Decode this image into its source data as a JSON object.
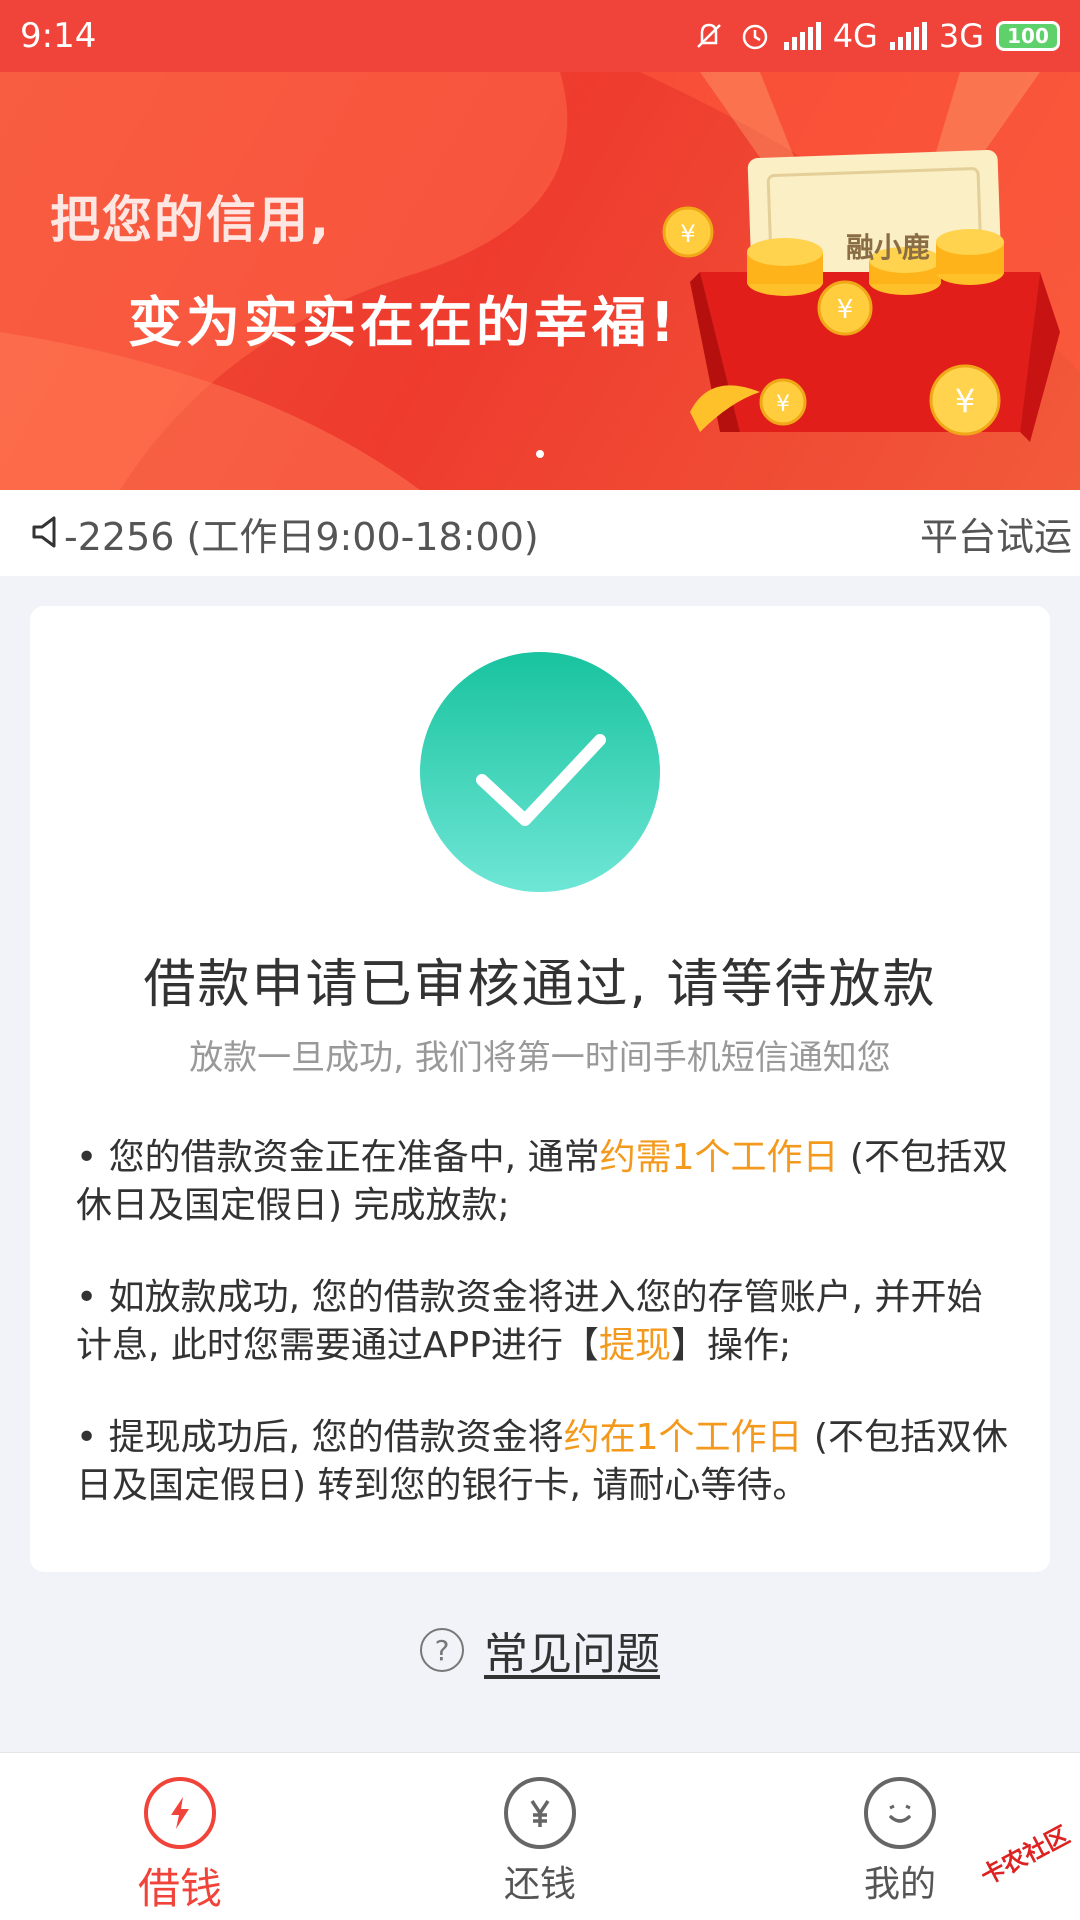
{
  "status_bar": {
    "time": "9:14",
    "network1": "4G",
    "network2": "3G",
    "battery": "100"
  },
  "banner": {
    "line1": "把您的信用,",
    "line2": "变为实实在在的幸福!",
    "brand": "融小鹿"
  },
  "notice": {
    "text": "-2256 (工作日9:00-18:00)",
    "text2": "平台试运"
  },
  "card": {
    "title": "借款申请已审核通过, 请等待放款",
    "subtitle": "放款一旦成功, 我们将第一时间手机短信通知您",
    "bullets": [
      {
        "pre": "• 您的借款资金正在准备中, 通常",
        "highlight": "约需1个工作日",
        "post": " (不包括双休日及国定假日) 完成放款;"
      },
      {
        "pre": "• 如放款成功, 您的借款资金将进入您的存管账户, 并开始计息, 此时您需要通过APP进行【",
        "highlight": "提现",
        "post": "】操作;"
      },
      {
        "pre": "• 提现成功后, 您的借款资金将",
        "highlight": "约在1个工作日",
        "post": " (不包括双休日及国定假日) 转到您的银行卡, 请耐心等待。"
      }
    ]
  },
  "faq": {
    "label": "常见问题"
  },
  "tabs": [
    {
      "label": "借钱",
      "icon": "lightning-icon"
    },
    {
      "label": "还钱",
      "icon": "yen-icon"
    },
    {
      "label": "我的",
      "icon": "smiley-icon"
    }
  ],
  "watermark": "卡农社区",
  "colors": {
    "brand_red": "#f0433a",
    "highlight_orange": "#f39a1e",
    "success_green": "#18c39f"
  }
}
